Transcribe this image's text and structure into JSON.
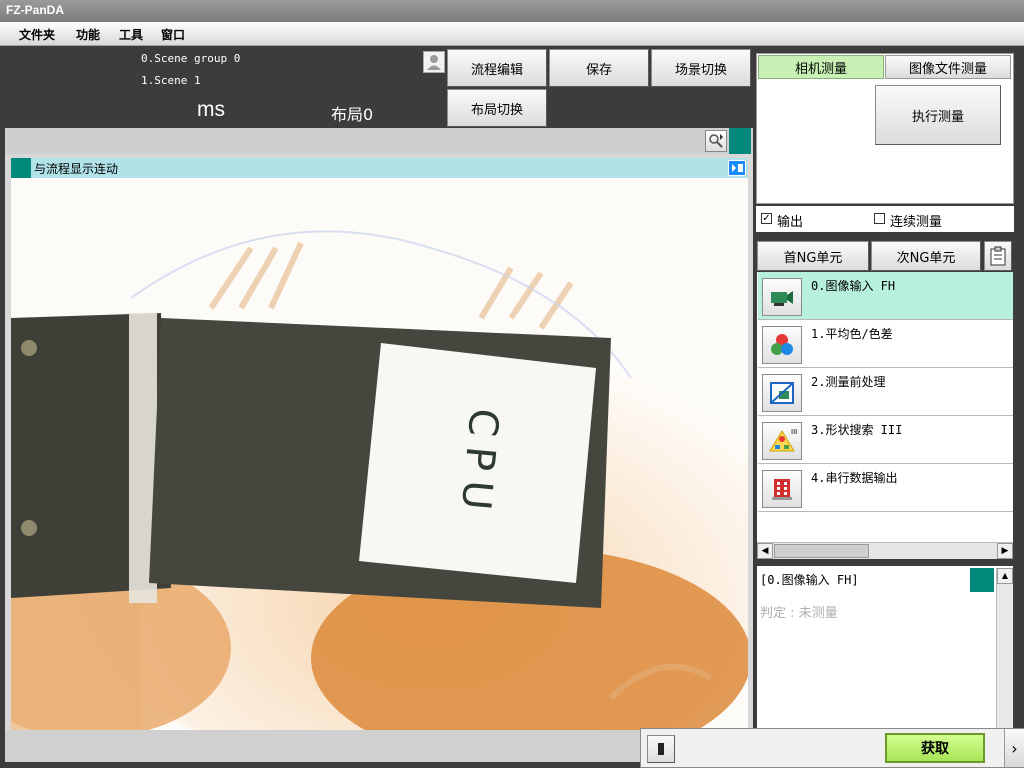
{
  "app": {
    "title": "FZ-PanDA"
  },
  "menu": [
    "文件夹",
    "功能",
    "工具",
    "窗口"
  ],
  "header": {
    "scene_group": "0.Scene group 0",
    "scene": "1.Scene 1",
    "time_unit": "ms",
    "layout": "布局0"
  },
  "toolbar": {
    "flow_edit": "流程编辑",
    "save": "保存",
    "scene_switch": "场景切换",
    "layout_switch": "布局切换"
  },
  "image_panel": {
    "title": "与流程显示连动",
    "image_text": "CPU"
  },
  "measure_tabs": {
    "camera": "相机测量",
    "image_file": "图像文件测量",
    "execute": "执行测量"
  },
  "options": {
    "output": "输出",
    "output_checked": true,
    "continuous": "连续测量",
    "continuous_checked": false
  },
  "ng_nav": {
    "first": "首NG单元",
    "next": "次NG单元"
  },
  "flow_units": [
    {
      "label": "0.图像输入 FH",
      "icon": "camera-icon",
      "selected": true
    },
    {
      "label": "1.平均色/色差",
      "icon": "color-balls-icon",
      "selected": false
    },
    {
      "label": "2.测量前处理",
      "icon": "preprocess-icon",
      "selected": false
    },
    {
      "label": "3.形状搜索 III",
      "icon": "shape-search-icon",
      "selected": false
    },
    {
      "label": "4.串行数据输出",
      "icon": "serial-output-icon",
      "selected": false
    }
  ],
  "detail": {
    "title": "[0.图像输入 FH]",
    "judgement": "判定 : 未测量"
  },
  "bottom": {
    "acquire": "获取"
  },
  "colors": {
    "teal": "#00897b",
    "cyan_bar": "#b0e2e8",
    "selected_row": "#b8f0e0",
    "tab_active": "#c8f0b4",
    "acquire": "#b6f26a"
  }
}
